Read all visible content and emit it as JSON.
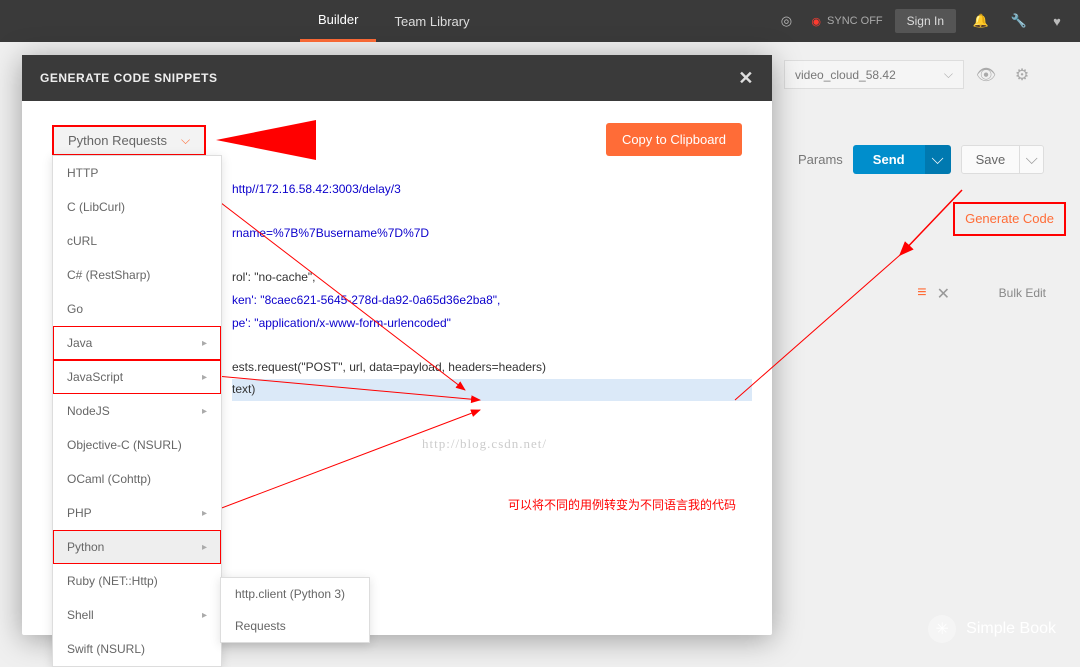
{
  "topbar": {
    "tabs": [
      "Builder",
      "Team Library"
    ],
    "sync_label": "SYNC OFF",
    "signin": "Sign In"
  },
  "toolbar": {
    "collection_sel": "video_cloud_58.42",
    "params": "Params",
    "send": "Send",
    "save": "Save",
    "generate_code": "Generate Code",
    "bulk_edit": "Bulk Edit"
  },
  "modal": {
    "title": "GENERATE CODE SNIPPETS",
    "lang_selected": "Python Requests",
    "copy": "Copy to Clipboard",
    "languages": [
      {
        "label": "HTTP"
      },
      {
        "label": "C (LibCurl)"
      },
      {
        "label": "cURL"
      },
      {
        "label": "C# (RestSharp)"
      },
      {
        "label": "Go"
      },
      {
        "label": "Java",
        "sub": true,
        "red": true
      },
      {
        "label": "JavaScript",
        "sub": true,
        "red": true
      },
      {
        "label": "NodeJS",
        "sub": true
      },
      {
        "label": "Objective-C (NSURL)"
      },
      {
        "label": "OCaml (Cohttp)"
      },
      {
        "label": "PHP",
        "sub": true
      },
      {
        "label": "Python",
        "sub": true,
        "red": true,
        "sel": true
      },
      {
        "label": "Ruby (NET::Http)"
      },
      {
        "label": "Shell",
        "sub": true
      },
      {
        "label": "Swift (NSURL)"
      }
    ],
    "submenu": [
      "http.client (Python 3)",
      "Requests"
    ]
  },
  "code": {
    "url": "http//172.16.58.42:3003/delay/3",
    "payload": "rname=%7B%7Busername%7D%7D",
    "h1": "rol': \"no-cache\",",
    "h2": "ken': \"8caec621-5645-278d-da92-0a65d36e2ba8\",",
    "h3": "pe': \"application/x-www-form-urlencoded\"",
    "req": "ests.request(\"POST\", url, data=payload, headers=headers)",
    "print": "text)"
  },
  "watermark": "http://blog.csdn.net/",
  "annotation": "可以将不同的用例转变为不同语言我的代码",
  "brand": "Simple Book"
}
